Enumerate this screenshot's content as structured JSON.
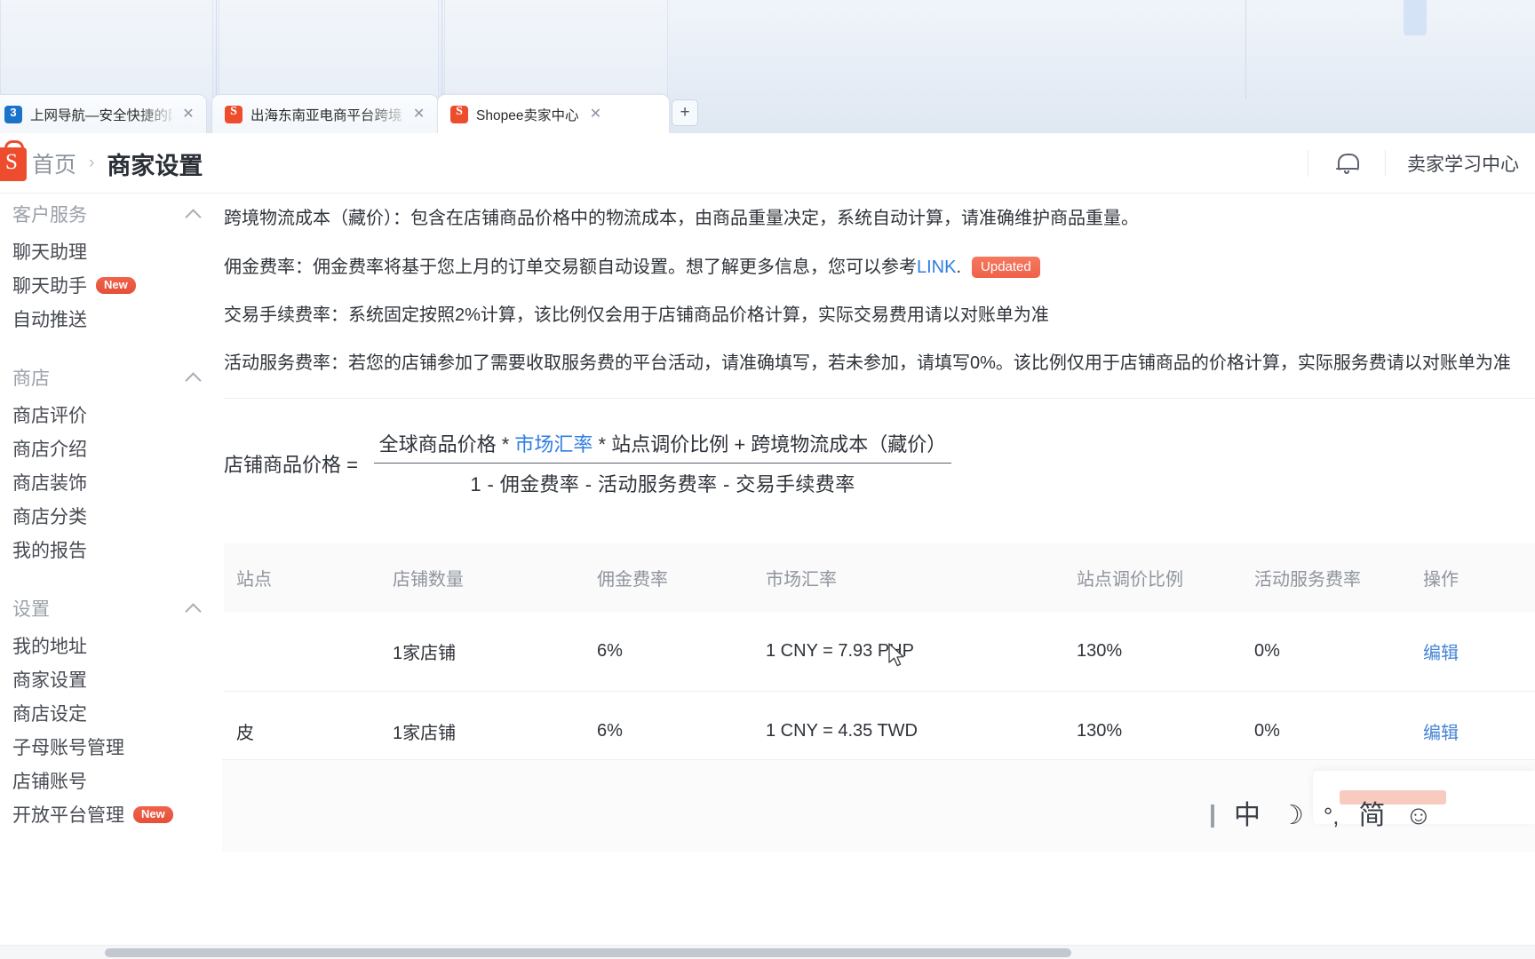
{
  "browser": {
    "tabs": [
      {
        "title": "上网导航—安全快捷的网",
        "favicon": "blue-3-icon",
        "active": false,
        "close_label": "✕"
      },
      {
        "title": "出海东南亚电商平台跨境",
        "favicon": "shopee-icon",
        "active": false,
        "close_label": "✕"
      },
      {
        "title": "Shopee卖家中心",
        "favicon": "shopee-icon",
        "active": true,
        "close_label": "✕"
      }
    ],
    "new_tab_label": "+"
  },
  "header": {
    "logo_letter": "S",
    "breadcrumb_home": "首页",
    "breadcrumb_separator": "›",
    "breadcrumb_current": "商家设置",
    "bell_icon": "bell-icon",
    "learning_center": "卖家学习中心"
  },
  "sidebar": {
    "groups": [
      {
        "title": "客户服务",
        "items": [
          {
            "label": "聊天助理",
            "badge": ""
          },
          {
            "label": "聊天助手",
            "badge": "New"
          },
          {
            "label": "自动推送",
            "badge": ""
          }
        ]
      },
      {
        "title": "商店",
        "items": [
          {
            "label": "商店评价",
            "badge": ""
          },
          {
            "label": "商店介绍",
            "badge": ""
          },
          {
            "label": "商店装饰",
            "badge": ""
          },
          {
            "label": "商店分类",
            "badge": ""
          },
          {
            "label": "我的报告",
            "badge": ""
          }
        ]
      },
      {
        "title": "设置",
        "items": [
          {
            "label": "我的地址",
            "badge": ""
          },
          {
            "label": "商家设置",
            "badge": ""
          },
          {
            "label": "商店设定",
            "badge": ""
          },
          {
            "label": "子母账号管理",
            "badge": ""
          },
          {
            "label": "店铺账号",
            "badge": ""
          },
          {
            "label": "开放平台管理",
            "badge": "New"
          }
        ]
      }
    ]
  },
  "main": {
    "notes": [
      {
        "text": "跨境物流成本（藏价）：包含在店铺商品价格中的物流成本，由商品重量决定，系统自动计算，请准确维护商品重量。",
        "link": "",
        "tail": "",
        "badge": ""
      },
      {
        "text": "佣金费率：佣金费率将基于您上月的订单交易额自动设置。想了解更多信息，您可以参考",
        "link": "LINK",
        "tail": ".",
        "badge": "Updated"
      },
      {
        "text": "交易手续费率：系统固定按照2%计算，该比例仅会用于店铺商品价格计算，实际交易费用请以对账单为准",
        "link": "",
        "tail": "",
        "badge": ""
      },
      {
        "text": "活动服务费率：若您的店铺参加了需要收取服务费的平台活动，请准确填写，若未参加，请填写0%。该比例仅用于店铺商品的价格计算，实际服务费请以对账单为准",
        "link": "",
        "tail": "",
        "badge": ""
      }
    ],
    "formula": {
      "lhs": "店铺商品价格 =",
      "numerator_pre": "全球商品价格  *  ",
      "numerator_link": "市场汇率",
      "numerator_post": "  *  站点调价比例  +  跨境物流成本（藏价）",
      "denominator": "1  -  佣金费率  -  活动服务费率  -  交易手续费率"
    },
    "table": {
      "columns": [
        "站点",
        "店铺数量",
        "佣金费率",
        "市场汇率",
        "站点调价比例",
        "活动服务费率",
        "操作"
      ],
      "rows": [
        {
          "site": "",
          "shop_count": "1家店铺",
          "commission": "6%",
          "exchange_rate": "1 CNY = 7.93 PHP",
          "site_adjust": "130%",
          "service_fee": "0%",
          "action": "编辑"
        },
        {
          "site": "皮",
          "shop_count": "1家店铺",
          "commission": "6%",
          "exchange_rate": "1 CNY = 4.35 TWD",
          "site_adjust": "130%",
          "service_fee": "0%",
          "action": "编辑"
        }
      ]
    }
  },
  "ime": {
    "items": [
      {
        "glyph": "中",
        "name": "language-mode-icon"
      },
      {
        "glyph": "☽",
        "name": "moon-icon"
      },
      {
        "glyph": "°,",
        "name": "punctuation-icon"
      },
      {
        "glyph": "简",
        "name": "simplified-chinese-icon"
      },
      {
        "glyph": "☺",
        "name": "emoji-icon"
      }
    ]
  },
  "colors": {
    "brand": "#ee4d2d",
    "link": "#2f7de1",
    "badge_new": "#e4503a",
    "text": "#2f333a"
  }
}
